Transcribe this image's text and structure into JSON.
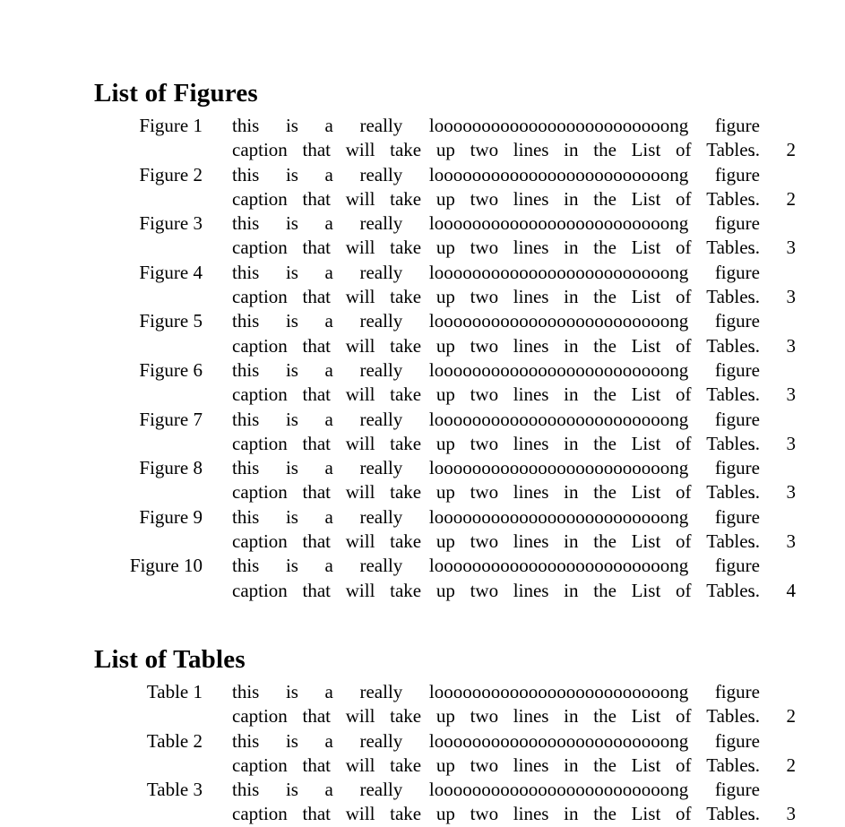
{
  "document": {
    "background_color": "#ffffff",
    "text_color": "#000000"
  },
  "caption_text": {
    "line1_words": [
      "this",
      "is",
      "a",
      "really"
    ],
    "long_word": "looooooooooooooooooooooooong",
    "line1_last_word": "figure",
    "line2_words": [
      "caption",
      "that",
      "will",
      "take",
      "up",
      "two",
      "lines",
      "in",
      "the",
      "List",
      "of",
      "Tables."
    ],
    "leader": "."
  },
  "sections": [
    {
      "heading": "List of Figures",
      "entries": [
        {
          "label": "Figure 1",
          "page": "2"
        },
        {
          "label": "Figure 2",
          "page": "2"
        },
        {
          "label": "Figure 3",
          "page": "3"
        },
        {
          "label": "Figure 4",
          "page": "3"
        },
        {
          "label": "Figure 5",
          "page": "3"
        },
        {
          "label": "Figure 6",
          "page": "3"
        },
        {
          "label": "Figure 7",
          "page": "3"
        },
        {
          "label": "Figure 8",
          "page": "3"
        },
        {
          "label": "Figure 9",
          "page": "3"
        },
        {
          "label": "Figure 10",
          "page": "4"
        }
      ]
    },
    {
      "heading": "List of Tables",
      "entries": [
        {
          "label": "Table 1",
          "page": "2"
        },
        {
          "label": "Table 2",
          "page": "2"
        },
        {
          "label": "Table 3",
          "page": "3"
        }
      ]
    }
  ]
}
